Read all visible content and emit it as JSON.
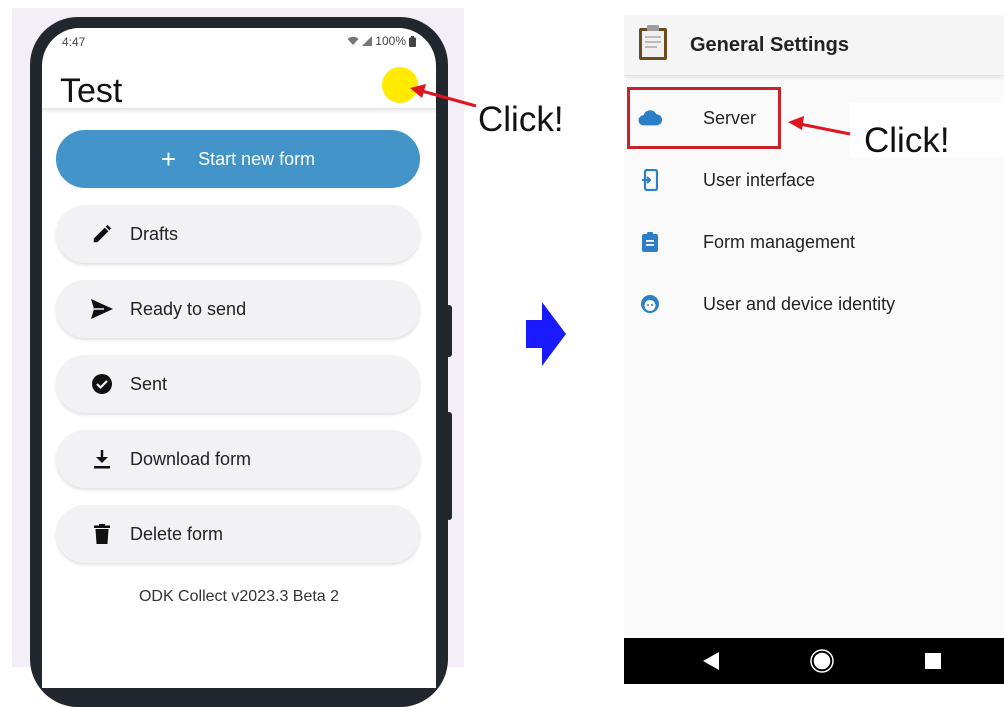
{
  "phone": {
    "status_time": "4:47",
    "battery": "100%",
    "app_title": "Test",
    "start_new_form": "Start new form",
    "menu": [
      {
        "label": "Drafts",
        "icon": "pencil-icon"
      },
      {
        "label": "Ready to send",
        "icon": "send-icon"
      },
      {
        "label": "Sent",
        "icon": "check-circle-icon"
      },
      {
        "label": "Download form",
        "icon": "download-icon"
      },
      {
        "label": "Delete form",
        "icon": "trash-icon"
      }
    ],
    "version": "ODK Collect v2023.3 Beta 2"
  },
  "annotations": {
    "click_left": "Click!",
    "click_right": "Click!",
    "highlight_color": "#ffea00",
    "arrow_color": "#e0141e",
    "transition_arrow_color": "#1a1aff"
  },
  "settings": {
    "title": "General Settings",
    "items": [
      {
        "label": "Server",
        "icon": "cloud-icon"
      },
      {
        "label": "User interface",
        "icon": "phone-login-icon"
      },
      {
        "label": "Form management",
        "icon": "clipboard-icon"
      },
      {
        "label": "User and device identity",
        "icon": "face-icon"
      }
    ],
    "accent_color": "#2a7fc6",
    "nav": [
      "back-icon",
      "home-icon",
      "recents-icon"
    ]
  }
}
